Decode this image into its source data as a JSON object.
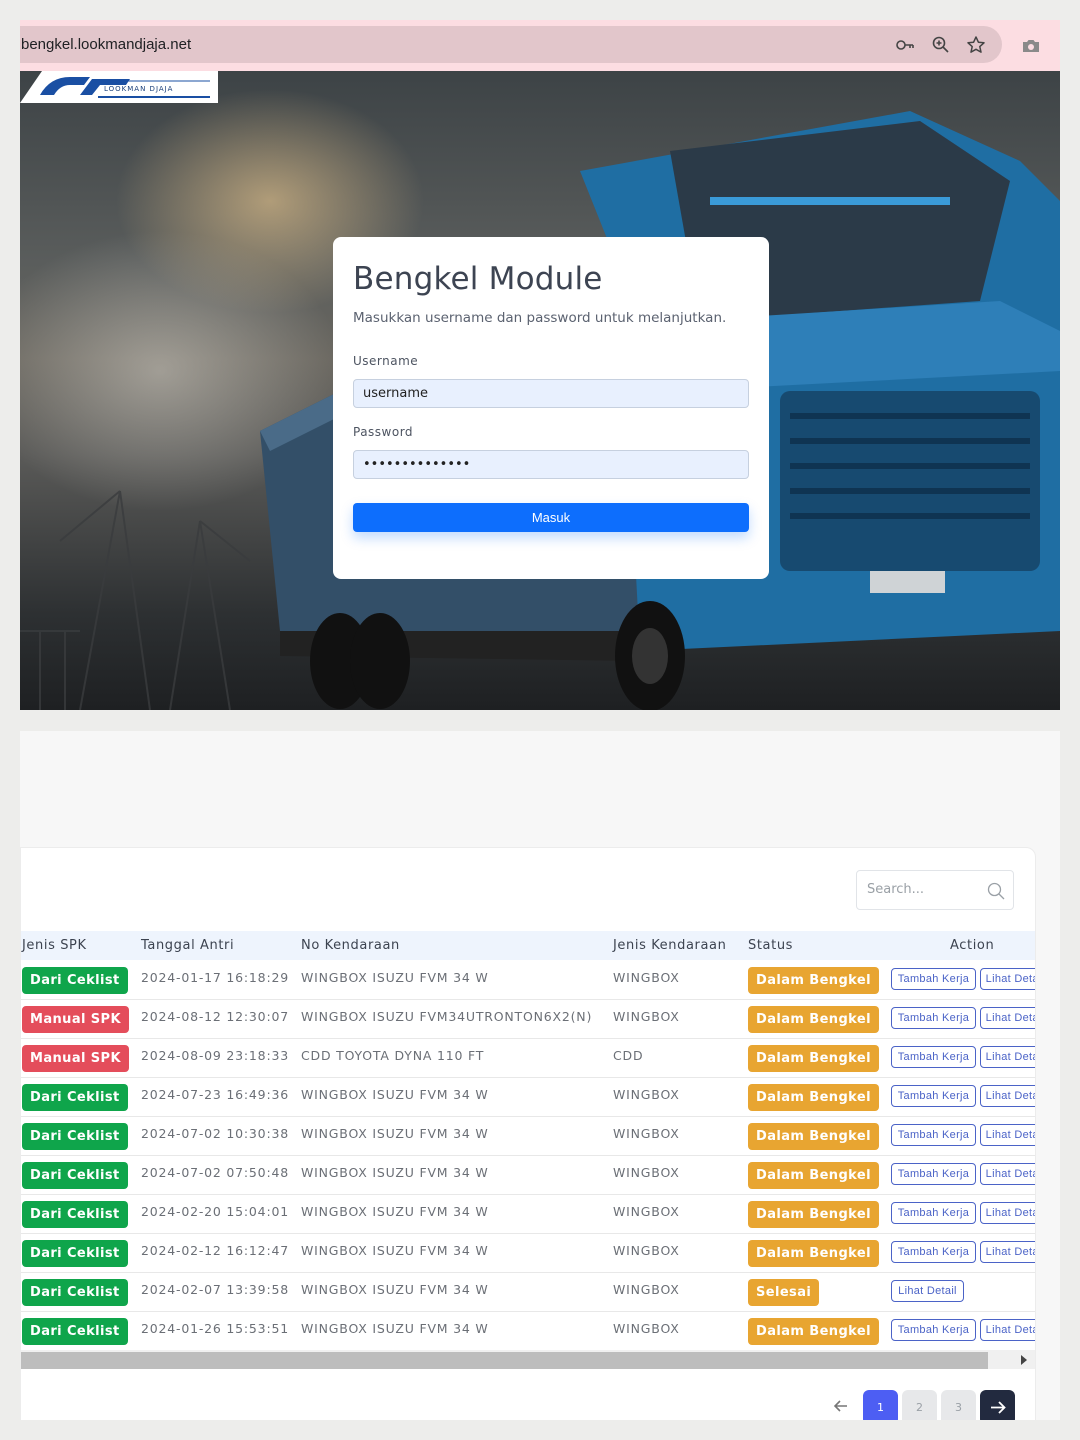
{
  "browser": {
    "url": "bengkel.lookmandjaja.net",
    "icons": [
      "key-icon",
      "zoom-icon",
      "star-icon",
      "camera-icon"
    ]
  },
  "login": {
    "logo_text": "LOOKMAN DJAJA",
    "title": "Bengkel Module",
    "subtitle": "Masukkan username dan password untuk melanjutkan.",
    "username_label": "Username",
    "username_value": "username",
    "password_label": "Password",
    "password_value": "••••••••••••••",
    "submit_label": "Masuk"
  },
  "table": {
    "search_placeholder": "Search...",
    "columns": [
      "Jenis SPK",
      "Tanggal Antri",
      "No Kendaraan",
      "Jenis Kendaraan",
      "Status",
      "Action"
    ],
    "rows": [
      {
        "jenis_spk": "Dari Ceklist",
        "tanggal": "2024-01-17 16:18:29",
        "no_kendaraan": "WINGBOX ISUZU FVM 34 W",
        "jenis_kendaraan": "WINGBOX",
        "status": "Dalam Bengkel",
        "actions": [
          "Tambah Kerja",
          "Lihat Detail"
        ]
      },
      {
        "jenis_spk": "Manual SPK",
        "tanggal": "2024-08-12 12:30:07",
        "no_kendaraan": "WINGBOX ISUZU FVM34UTRONTON6X2(N)",
        "jenis_kendaraan": "WINGBOX",
        "status": "Dalam Bengkel",
        "actions": [
          "Tambah Kerja",
          "Lihat Detail"
        ]
      },
      {
        "jenis_spk": "Manual SPK",
        "tanggal": "2024-08-09 23:18:33",
        "no_kendaraan": "CDD TOYOTA DYNA 110 FT",
        "jenis_kendaraan": "CDD",
        "status": "Dalam Bengkel",
        "actions": [
          "Tambah Kerja",
          "Lihat Detail"
        ]
      },
      {
        "jenis_spk": "Dari Ceklist",
        "tanggal": "2024-07-23 16:49:36",
        "no_kendaraan": "WINGBOX ISUZU FVM 34 W",
        "jenis_kendaraan": "WINGBOX",
        "status": "Dalam Bengkel",
        "actions": [
          "Tambah Kerja",
          "Lihat Detail"
        ]
      },
      {
        "jenis_spk": "Dari Ceklist",
        "tanggal": "2024-07-02 10:30:38",
        "no_kendaraan": "WINGBOX ISUZU FVM 34 W",
        "jenis_kendaraan": "WINGBOX",
        "status": "Dalam Bengkel",
        "actions": [
          "Tambah Kerja",
          "Lihat Detail"
        ]
      },
      {
        "jenis_spk": "Dari Ceklist",
        "tanggal": "2024-07-02 07:50:48",
        "no_kendaraan": "WINGBOX ISUZU FVM 34 W",
        "jenis_kendaraan": "WINGBOX",
        "status": "Dalam Bengkel",
        "actions": [
          "Tambah Kerja",
          "Lihat Detail"
        ]
      },
      {
        "jenis_spk": "Dari Ceklist",
        "tanggal": "2024-02-20 15:04:01",
        "no_kendaraan": "WINGBOX ISUZU FVM 34 W",
        "jenis_kendaraan": "WINGBOX",
        "status": "Dalam Bengkel",
        "actions": [
          "Tambah Kerja",
          "Lihat Detail"
        ]
      },
      {
        "jenis_spk": "Dari Ceklist",
        "tanggal": "2024-02-12 16:12:47",
        "no_kendaraan": "WINGBOX ISUZU FVM 34 W",
        "jenis_kendaraan": "WINGBOX",
        "status": "Dalam Bengkel",
        "actions": [
          "Tambah Kerja",
          "Lihat Detail"
        ]
      },
      {
        "jenis_spk": "Dari Ceklist",
        "tanggal": "2024-02-07 13:39:58",
        "no_kendaraan": "WINGBOX ISUZU FVM 34 W",
        "jenis_kendaraan": "WINGBOX",
        "status": "Selesai",
        "actions": [
          "Lihat Detail"
        ]
      },
      {
        "jenis_spk": "Dari Ceklist",
        "tanggal": "2024-01-26 15:53:51",
        "no_kendaraan": "WINGBOX ISUZU FVM 34 W",
        "jenis_kendaraan": "WINGBOX",
        "status": "Dalam Bengkel",
        "actions": [
          "Tambah Kerja",
          "Lihat Detail"
        ]
      }
    ],
    "pagination": {
      "pages": [
        "1",
        "2",
        "3"
      ],
      "current": "1"
    }
  },
  "colors": {
    "primary": "#0d6efd",
    "badge_green": "#0fa54b",
    "badge_red": "#e44d5b",
    "badge_orange": "#e8a531",
    "action_blue": "#4b63c7",
    "pager_active": "#4d5ef3"
  }
}
